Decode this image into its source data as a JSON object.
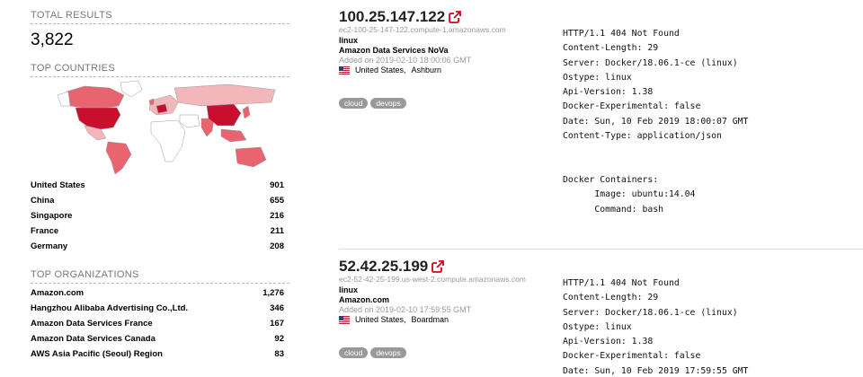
{
  "total": {
    "title": "TOTAL RESULTS",
    "value": "3,822"
  },
  "countries": {
    "title": "TOP COUNTRIES",
    "items": [
      {
        "name": "United States",
        "count": "901"
      },
      {
        "name": "China",
        "count": "655"
      },
      {
        "name": "Singapore",
        "count": "216"
      },
      {
        "name": "France",
        "count": "211"
      },
      {
        "name": "Germany",
        "count": "208"
      }
    ]
  },
  "organizations": {
    "title": "TOP ORGANIZATIONS",
    "items": [
      {
        "name": "Amazon.com",
        "count": "1,276"
      },
      {
        "name": "Hangzhou Alibaba Advertising Co.,Ltd.",
        "count": "346"
      },
      {
        "name": "Amazon Data Services France",
        "count": "167"
      },
      {
        "name": "Amazon Data Services Canada",
        "count": "92"
      },
      {
        "name": "AWS Asia Pacific (Seoul) Region",
        "count": "83"
      }
    ]
  },
  "colors": {
    "accent": "#d0021b",
    "map_dark": "#c8102e",
    "map_mid": "#e8646f",
    "map_light": "#f2b6bb",
    "map_base": "#ffffff"
  },
  "results": [
    {
      "ip": "100.25.147.122",
      "hostname": "ec2-100-25-147-122.compute-1.amazonaws.com",
      "os": "linux",
      "org": "Amazon Data Services NoVa",
      "added": "Added on 2019-02-10 18:00:06 GMT",
      "country": "United States,",
      "city": "Ashburn",
      "tags": [
        "cloud",
        "devops"
      ],
      "banner": "HTTP/1.1 404 Not Found\nContent-Length: 29\nServer: Docker/18.06.1-ce (linux)\nOstype: linux\nApi-Version: 1.38\nDocker-Experimental: false\nDate: Sun, 10 Feb 2019 18:00:07 GMT\nContent-Type: application/json\n\n\nDocker Containers:\n      Image: ubuntu:14.04\n      Command: bash"
    },
    {
      "ip": "52.42.25.199",
      "hostname": "ec2-52-42-25-199.us-west-2.compute.amazonaws.com",
      "os": "linux",
      "org": "Amazon.com",
      "added": "Added on 2019-02-10 17:59:55 GMT",
      "country": "United States,",
      "city": "Boardman",
      "tags": [
        "cloud",
        "devops"
      ],
      "banner": "HTTP/1.1 404 Not Found\nContent-Length: 29\nServer: Docker/18.06.1-ce (linux)\nOstype: linux\nApi-Version: 1.38\nDocker-Experimental: false\nDate: Sun, 10 Feb 2019 17:59:55 GMT"
    }
  ]
}
